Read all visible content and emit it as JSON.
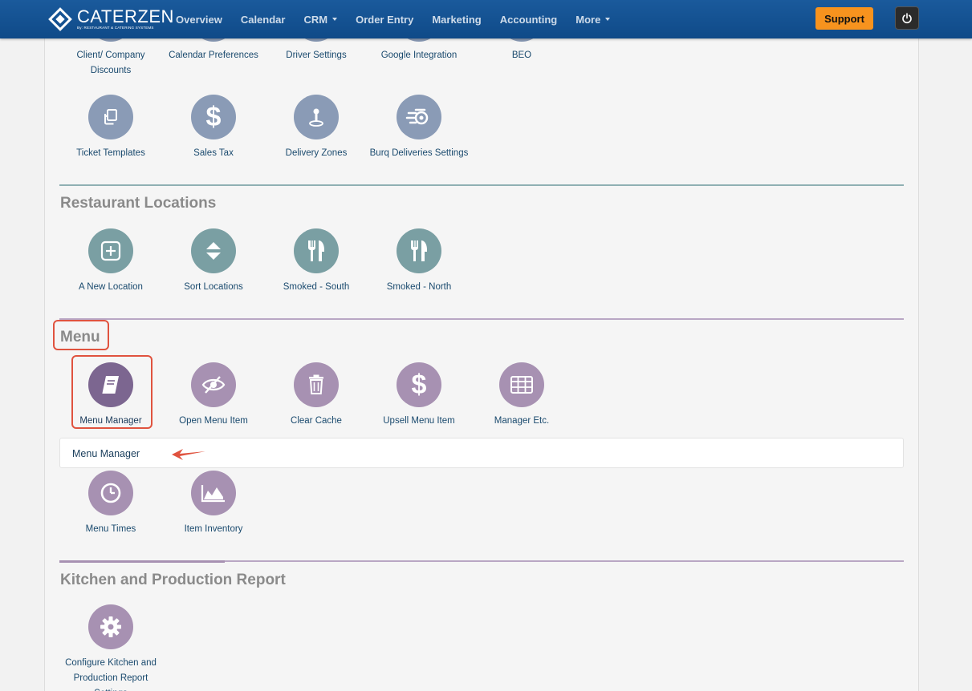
{
  "nav": {
    "logo_text": "CATERZEN",
    "logo_sub": "By: RESTAURANT & CATERING SYSTEMS",
    "items": [
      {
        "label": "Overview"
      },
      {
        "label": "Calendar"
      },
      {
        "label": "CRM"
      },
      {
        "label": "Order Entry"
      },
      {
        "label": "Marketing"
      },
      {
        "label": "Accounting"
      },
      {
        "label": "More"
      }
    ],
    "support_label": "Support"
  },
  "settings": {
    "row1": [
      {
        "label": "Client/ Company Discounts"
      },
      {
        "label": "Calendar Preferences"
      },
      {
        "label": "Driver Settings"
      },
      {
        "label": "Google Integration"
      },
      {
        "label": "BEO"
      }
    ],
    "row2": [
      {
        "label": "Ticket Templates",
        "icon": "copy-icon"
      },
      {
        "label": "Sales Tax",
        "icon": "dollar-icon"
      },
      {
        "label": "Delivery Zones",
        "icon": "map-pin-icon"
      },
      {
        "label": "Burq Deliveries Settings",
        "icon": "fast-delivery-icon"
      }
    ]
  },
  "restaurant_locations": {
    "title": "Restaurant Locations",
    "items": [
      {
        "label": "A New Location",
        "icon": "plus-square-icon"
      },
      {
        "label": "Sort Locations",
        "icon": "sort-icon"
      },
      {
        "label": "Smoked - South",
        "icon": "utensils-icon"
      },
      {
        "label": "Smoked - North",
        "icon": "utensils-icon"
      }
    ]
  },
  "menu": {
    "title": "Menu",
    "items": [
      {
        "label": "Menu Manager",
        "icon": "book-icon"
      },
      {
        "label": "Open Menu Item",
        "icon": "eye-slash-icon"
      },
      {
        "label": "Clear Cache",
        "icon": "trash-icon"
      },
      {
        "label": "Upsell Menu Item",
        "icon": "dollar-icon"
      },
      {
        "label": "Manager Etc.",
        "icon": "grid-icon"
      }
    ],
    "tooltip": "Menu Manager",
    "items2": [
      {
        "label": "Menu Times",
        "icon": "clock-icon"
      },
      {
        "label": "Item Inventory",
        "icon": "area-chart-icon"
      }
    ]
  },
  "kitchen": {
    "title": "Kitchen and Production Report",
    "items": [
      {
        "label": "Configure Kitchen and Production Report Settings",
        "icon": "gear-icon"
      }
    ]
  },
  "colors": {
    "nav_bg": "#1a5a9c",
    "support": "#f7931e",
    "highlight": "#e0533f"
  }
}
